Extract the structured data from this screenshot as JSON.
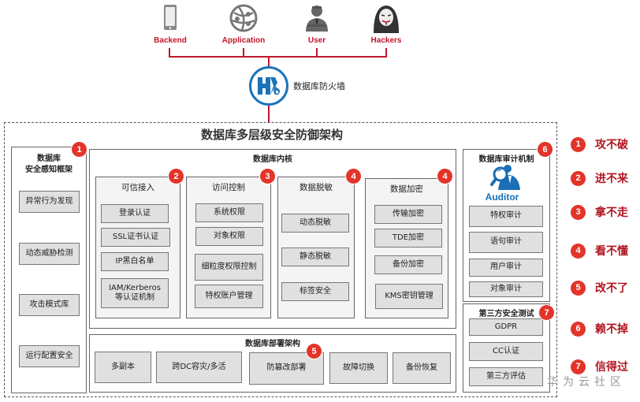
{
  "actors": [
    {
      "label": "Backend",
      "icon": "smartphone-icon"
    },
    {
      "label": "Application",
      "icon": "globe-network-icon"
    },
    {
      "label": "User",
      "icon": "businessman-icon"
    },
    {
      "label": "Hackers",
      "icon": "hacker-mask-icon"
    }
  ],
  "firewall": {
    "label": "数据库防火墙",
    "icon": "firewall-flame-icon"
  },
  "main_title": "数据库多层级安全防御架构",
  "perception": {
    "title_line1": "数据库",
    "title_line2": "安全感知框架",
    "badge": "1",
    "items": [
      "异常行为发现",
      "动态威胁检测",
      "攻击模式库",
      "运行配置安全"
    ]
  },
  "kernel": {
    "title": "数据库内核",
    "groups": [
      {
        "title": "可信接入",
        "badge": "2",
        "items": [
          "登录认证",
          "SSL证书认证",
          "IP黑白名单",
          "IAM/Kerberos\n等认证机制"
        ]
      },
      {
        "title": "访问控制",
        "badge": "3",
        "items": [
          "系统权限",
          "对象权限",
          "细粒度权限控制",
          "特权账户管理"
        ]
      },
      {
        "title": "数据脱敏",
        "badge": "4",
        "items": [
          "动态脱敏",
          "静态脱敏",
          "标签安全"
        ]
      },
      {
        "title": "数据加密",
        "badge": "4",
        "items": [
          "传输加密",
          "TDE加密",
          "备份加密",
          "KMS密钥管理"
        ]
      }
    ]
  },
  "deployment": {
    "title": "数据库部署架构",
    "badge": "5",
    "items": [
      "多副本",
      "跨DC容灾/多活",
      "防篡改部署",
      "故障切换",
      "备份恢复"
    ]
  },
  "audit": {
    "title": "数据库审计机制",
    "badge": "6",
    "icon_label": "Auditor",
    "items": [
      "特权审计",
      "语句审计",
      "用户审计",
      "对象审计"
    ]
  },
  "third_party": {
    "title": "第三方安全测试",
    "badge": "7",
    "items": [
      "GDPR",
      "CC认证",
      "第三方评估"
    ]
  },
  "legend": [
    {
      "badge": "1",
      "text": "攻不破"
    },
    {
      "badge": "2",
      "text": "进不来"
    },
    {
      "badge": "3",
      "text": "拿不走"
    },
    {
      "badge": "4",
      "text": "看不懂"
    },
    {
      "badge": "5",
      "text": "改不了"
    },
    {
      "badge": "6",
      "text": "赖不掉"
    },
    {
      "badge": "7",
      "text": "信得过"
    }
  ],
  "watermark": "华为云社区",
  "colors": {
    "accent_red": "#c0162c",
    "badge_red": "#e3342a",
    "firewall_blue": "#1a73b8",
    "legend_text": "#b0141f"
  }
}
